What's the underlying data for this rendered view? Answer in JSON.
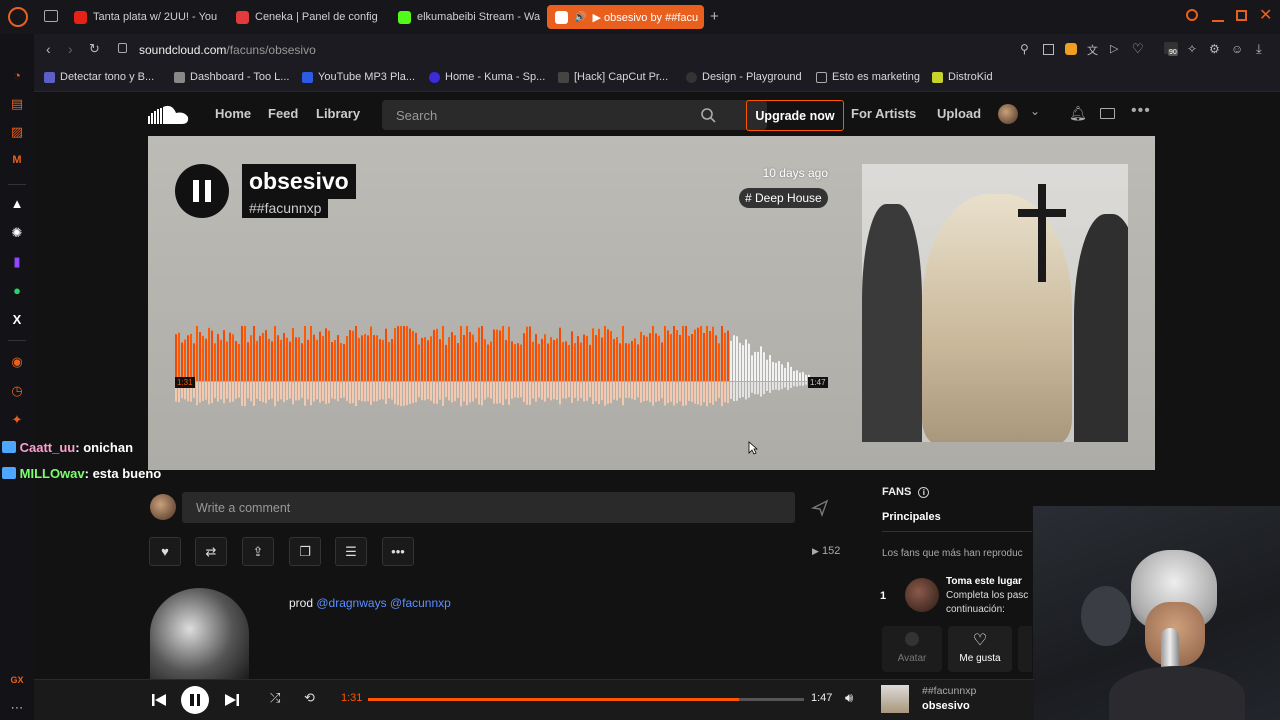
{
  "browser": {
    "tabs": [
      {
        "label": "Tanta plata w/ 2UU! - You",
        "color": "#e62117"
      },
      {
        "label": "Ceneka | Panel de config",
        "color": "#e33b3b"
      },
      {
        "label": "elkumabeibi Stream - Wa",
        "color": "#53fc18"
      },
      {
        "label": "▶ obsesivo by ##facu",
        "color": "#ff5500"
      }
    ],
    "url_domain": "soundcloud.com",
    "url_path": "/facuns/obsesivo",
    "extension_badge": "90",
    "bookmarks": [
      {
        "label": "Detectar tono y B...",
        "color": "#5b5fc7"
      },
      {
        "label": "Dashboard - Too L...",
        "color": "#888"
      },
      {
        "label": "YouTube MP3 Pla...",
        "color": "#2d5be3"
      },
      {
        "label": "Home - Kuma - Sp...",
        "color": "#3b2bd9"
      },
      {
        "label": "[Hack] CapCut Pr...",
        "color": "#444"
      },
      {
        "label": "Design - Playground",
        "color": "#333"
      },
      {
        "label": "Esto es marketing",
        "color": "#aaa"
      },
      {
        "label": "DistroKid",
        "color": "#c6d32b"
      }
    ]
  },
  "chat": [
    {
      "user": "Caatt_uu",
      "msg": ": onichan",
      "color": "#ff9fcf"
    },
    {
      "user": "MILLOwav",
      "msg": ": esta bueno",
      "color": "#7cff6e"
    }
  ],
  "header": {
    "home": "Home",
    "feed": "Feed",
    "library": "Library",
    "search_placeholder": "Search",
    "upgrade": "Upgrade now",
    "for_artists": "For Artists",
    "upload": "Upload"
  },
  "track": {
    "title": "obsesivo",
    "artist": "##facunnxp",
    "posted": "10 days ago",
    "tag": "# Deep House",
    "elapsed": "1:31",
    "duration": "1:47",
    "progress": 0.85,
    "plays": "152"
  },
  "comment": {
    "placeholder": "Write a comment"
  },
  "description": {
    "prefix": "prod ",
    "mention1": "@dragnways",
    "mention2": "@facunnxp"
  },
  "fans": {
    "title": "FANS",
    "tab": "Principales",
    "subtitle": "Los fans que más han reproduc",
    "rank": "1",
    "cta_title": "Toma este lugar",
    "cta_text1": "Completa los pasc",
    "cta_text2": "continuación:",
    "avatar_label": "Avatar",
    "like_label": "Me gusta"
  },
  "player": {
    "elapsed": "1:31",
    "duration": "1:47",
    "progress": 0.85,
    "artist": "##facunnxp",
    "title": "obsesivo"
  },
  "colors": {
    "accent": "#ff5500",
    "link": "#5b8fff"
  }
}
